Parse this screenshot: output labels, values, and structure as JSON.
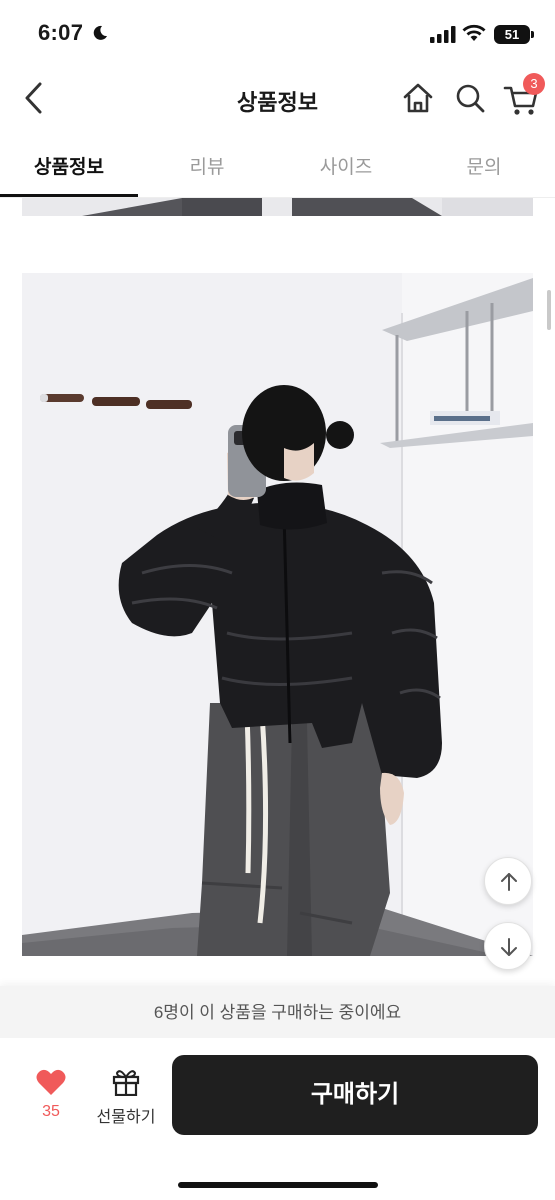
{
  "status_bar": {
    "time": "6:07",
    "battery": "51",
    "icons": [
      "moon-icon",
      "signal-icon",
      "wifi-icon",
      "battery-icon"
    ]
  },
  "header": {
    "title": "상품정보",
    "cart_count": "3",
    "icons": [
      "back-arrow-icon",
      "home-icon",
      "search-icon",
      "cart-icon"
    ]
  },
  "tabs": [
    {
      "label": "상품정보",
      "active": true
    },
    {
      "label": "리뷰",
      "active": false
    },
    {
      "label": "사이즈",
      "active": false
    },
    {
      "label": "문의",
      "active": false
    }
  ],
  "product": {
    "photo": "product-photo",
    "floating_buttons": [
      "scroll-up-icon",
      "scroll-down-icon"
    ]
  },
  "bottom": {
    "buyers_text": "6명이 이 상품을 구매하는 중이에요",
    "like_count": "35",
    "gift_label": "선물하기",
    "buy_label": "구매하기",
    "accent_color": "#f05a5a",
    "buy_button_color": "#1f1f1f"
  }
}
